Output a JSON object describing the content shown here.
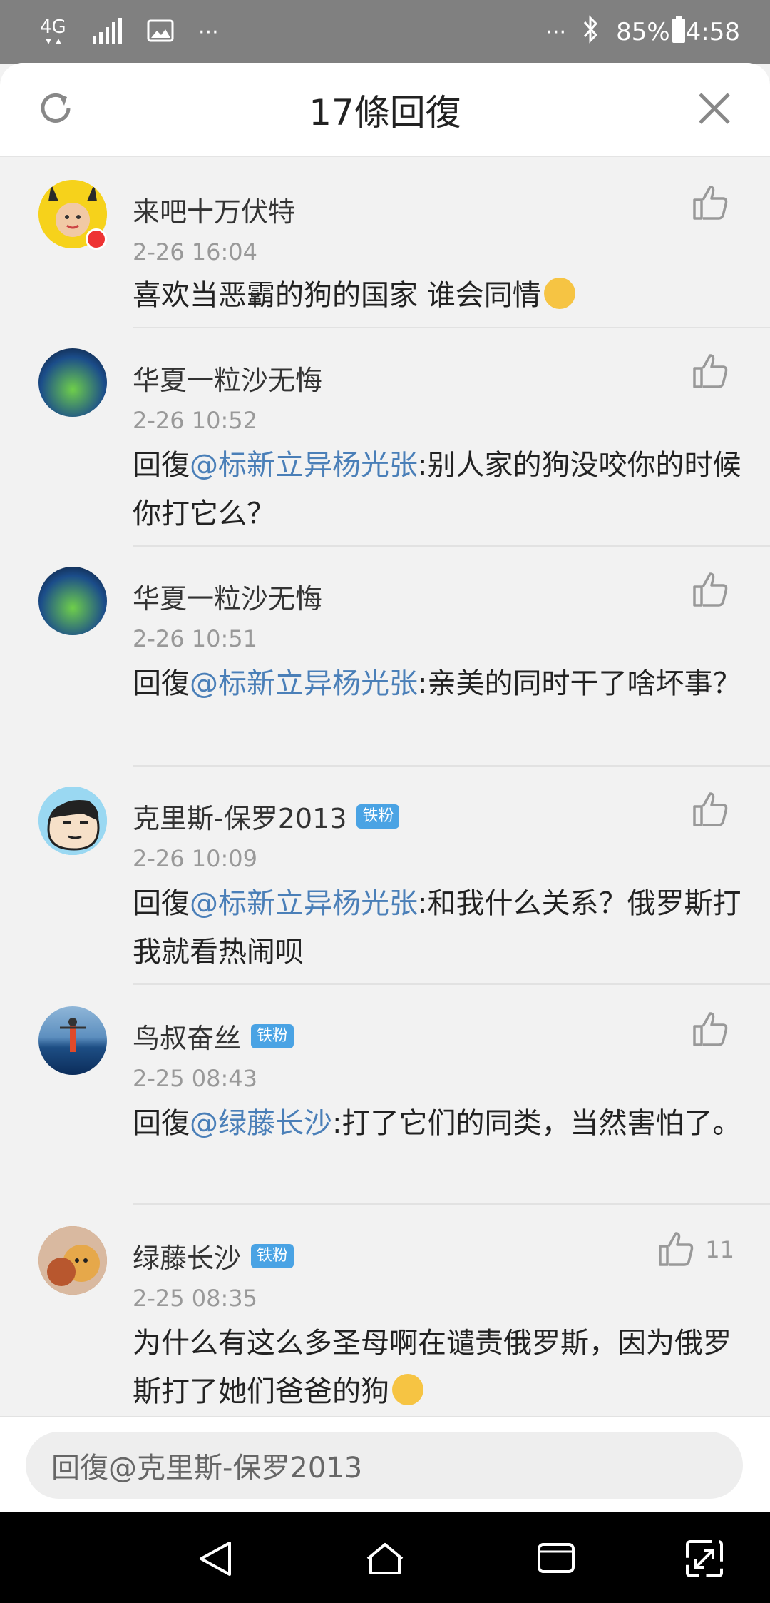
{
  "status_bar": {
    "network": "4G",
    "more_left": "···",
    "more_right": "···",
    "battery": "85%",
    "time": "4:58"
  },
  "header": {
    "title": "17條回復",
    "refresh_icon": "refresh-icon",
    "close_icon": "close-icon"
  },
  "comments": [
    {
      "user": "来吧十万伏特",
      "badge": "",
      "time": "2-26 16:04",
      "prefix": "",
      "mention": "",
      "body": "喜欢当恶霸的狗的国家 谁会同情",
      "likes": ""
    },
    {
      "user": "华夏一粒沙无悔",
      "badge": "",
      "time": "2-26 10:52",
      "prefix": "回復",
      "mention": "@标新立异杨光张",
      "body": ":别人家的狗没咬你的时候你打它么？",
      "likes": ""
    },
    {
      "user": "华夏一粒沙无悔",
      "badge": "",
      "time": "2-26 10:51",
      "prefix": "回復",
      "mention": "@标新立异杨光张",
      "body": ":亲美的同时干了啥坏事？",
      "likes": ""
    },
    {
      "user": "克里斯-保罗2013",
      "badge": "铁粉",
      "time": "2-26 10:09",
      "prefix": "回復",
      "mention": "@标新立异杨光张",
      "body": ":和我什么关系？俄罗斯打我就看热闹呗",
      "likes": ""
    },
    {
      "user": "鸟叔奋丝",
      "badge": "铁粉",
      "time": "2-25 08:43",
      "prefix": "回復",
      "mention": "@绿藤长沙",
      "body": ":打了它们的同类，当然害怕了。",
      "likes": ""
    },
    {
      "user": "绿藤长沙",
      "badge": "铁粉",
      "time": "2-25 08:35",
      "prefix": "",
      "mention": "",
      "body": "为什么有这么多圣母啊在谴责俄罗斯，因为俄罗斯打了她们爸爸的狗",
      "likes": "11"
    }
  ],
  "input": {
    "placeholder": "回復@克里斯-保罗2013"
  },
  "nav": [
    "back-icon",
    "home-icon",
    "recents-icon",
    "expand-icon"
  ]
}
